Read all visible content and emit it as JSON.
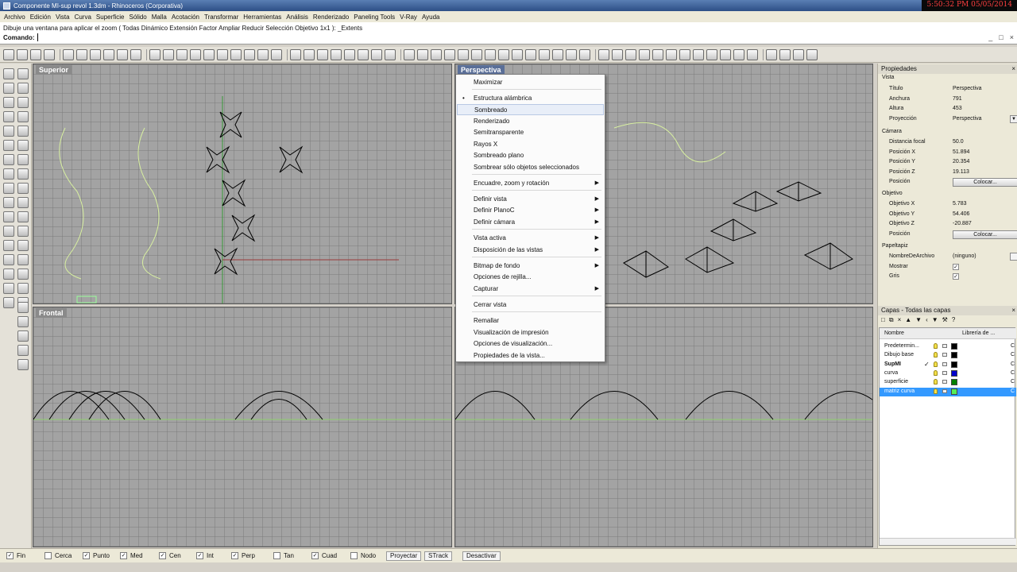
{
  "window": {
    "title": "Componente MI-sup revol 1.3dm - Rhinoceros (Corporativa)",
    "clock": "5:50:32 PM 05/05/2014"
  },
  "menubar": [
    "Archivo",
    "Edición",
    "Vista",
    "Curva",
    "Superficie",
    "Sólido",
    "Malla",
    "Acotación",
    "Transformar",
    "Herramientas",
    "Análisis",
    "Renderizado",
    "Paneling Tools",
    "V-Ray",
    "Ayuda"
  ],
  "command": {
    "history": "Dibuje una ventana para aplicar el zoom ( Todas  Dinámico  Extensión  Factor  Ampliar  Reducir  Selección  Objetivo  1x1 ): _Extents",
    "prompt": "Comando:",
    "window_buttons": [
      "_",
      "□",
      "×"
    ]
  },
  "viewports": {
    "top": "Superior",
    "front": "Frontal",
    "perspective": "Perspectiva"
  },
  "context_menu": {
    "items": [
      {
        "label": "Maximizar"
      },
      {
        "label": "Estructura alámbrica",
        "bullet": "•"
      },
      {
        "label": "Sombreado",
        "hover": true
      },
      {
        "label": "Renderizado"
      },
      {
        "label": "Semitransparente"
      },
      {
        "label": "Rayos X"
      },
      {
        "label": "Sombreado plano"
      },
      {
        "label": "Sombrear sólo objetos seleccionados"
      },
      {
        "label": "Encuadre, zoom y rotación",
        "arrow": "▶"
      },
      {
        "label": "Definir vista",
        "arrow": "▶"
      },
      {
        "label": "Definir PlanoC",
        "arrow": "▶"
      },
      {
        "label": "Definir cámara",
        "arrow": "▶"
      },
      {
        "label": "Vista activa",
        "arrow": "▶"
      },
      {
        "label": "Disposición de las vistas",
        "arrow": "▶"
      },
      {
        "label": "Bitmap de fondo",
        "arrow": "▶"
      },
      {
        "label": "Opciones de rejilla..."
      },
      {
        "label": "Capturar",
        "arrow": "▶"
      },
      {
        "label": "Cerrar vista"
      },
      {
        "label": "Remallar"
      },
      {
        "label": "Visualización de impresión"
      },
      {
        "label": "Opciones de visualización..."
      },
      {
        "label": "Propiedades de la vista..."
      }
    ]
  },
  "properties": {
    "header": "Propiedades",
    "close": "×",
    "sections": {
      "vista": "Vista",
      "camara": "Cámara",
      "objetivo": "Objetivo",
      "papeltapiz": "Papeltapiz"
    },
    "vista": [
      {
        "label": "Título",
        "value": "Perspectiva"
      },
      {
        "label": "Anchura",
        "value": "791"
      },
      {
        "label": "Altura",
        "value": "453"
      },
      {
        "label": "Proyección",
        "value": "Perspectiva",
        "dropdown": "▼"
      }
    ],
    "camara": [
      {
        "label": "Distancia focal",
        "value": "50.0"
      },
      {
        "label": "Posición X",
        "value": "51.894"
      },
      {
        "label": "Posición Y",
        "value": "20.354"
      },
      {
        "label": "Posición Z",
        "value": "19.113"
      },
      {
        "label": "Posición",
        "button": "Colocar..."
      }
    ],
    "objetivo": [
      {
        "label": "Objetivo X",
        "value": "5.783"
      },
      {
        "label": "Objetivo Y",
        "value": "54.406"
      },
      {
        "label": "Objetivo Z",
        "value": "-20.887"
      },
      {
        "label": "Posición",
        "button": "Colocar..."
      }
    ],
    "papeltapiz": [
      {
        "label": "NombreDeArchivo",
        "value": "(ninguno)"
      },
      {
        "label": "Mostrar",
        "check": "✓"
      },
      {
        "label": "Gris",
        "check": "✓"
      }
    ]
  },
  "layers": {
    "header": "Capas - Todas las capas",
    "close": "×",
    "toolbar_glyphs": [
      "□",
      "⧉",
      "×",
      "▲",
      "▼",
      "‹",
      "▼",
      "⚒",
      "?"
    ],
    "columns": {
      "name": "Nombre",
      "material": "Librería de ..."
    },
    "rows": [
      {
        "name": "Predetermin...",
        "color": "#000000",
        "material": "C"
      },
      {
        "name": "Dibujo base",
        "color": "#000000",
        "material": "C"
      },
      {
        "name": "SupMI",
        "current": "✓",
        "color": "#000000",
        "material": "C"
      },
      {
        "name": "curva",
        "color": "#0000cc",
        "material": "C"
      },
      {
        "name": "superficie",
        "color": "#008000",
        "material": "C"
      },
      {
        "name": "matriz curva",
        "color": "#55ee55",
        "material": "C",
        "selected": true
      }
    ]
  },
  "status": {
    "snaps": [
      {
        "label": "Fin",
        "checked": "✓"
      },
      {
        "label": "Cerca",
        "checked": ""
      },
      {
        "label": "Punto",
        "checked": "✓"
      },
      {
        "label": "Med",
        "checked": "✓"
      },
      {
        "label": "Cen",
        "checked": "✓"
      },
      {
        "label": "Int",
        "checked": "✓"
      },
      {
        "label": "Perp",
        "checked": "✓"
      },
      {
        "label": "Tan",
        "checked": ""
      },
      {
        "label": "Cuad",
        "checked": "✓"
      },
      {
        "label": "Nodo",
        "checked": ""
      }
    ],
    "buttons": [
      "Proyectar",
      "STrack",
      "Desactivar"
    ]
  }
}
